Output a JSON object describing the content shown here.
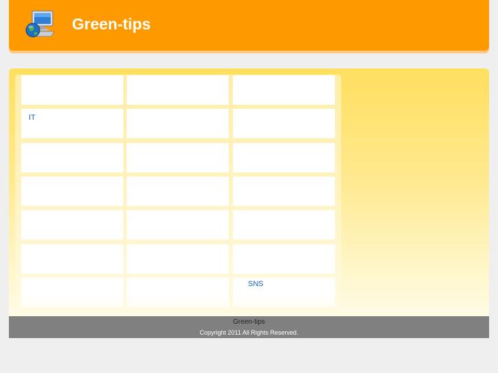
{
  "header": {
    "title": "Green-tips",
    "logo_icon": "computer-globe-icon",
    "background": "#ff9900"
  },
  "grid": {
    "rows": [
      [
        "",
        "",
        ""
      ],
      [
        "IT",
        "",
        ""
      ],
      [
        "",
        "",
        ""
      ],
      [
        "",
        "",
        ""
      ],
      [
        "",
        "",
        ""
      ],
      [
        "",
        "",
        ""
      ],
      [
        "",
        "",
        "SNS"
      ]
    ],
    "link_color": "#1a5fb4"
  },
  "footer": {
    "title": "Green-tips",
    "copyright": "Copyright 2011  All Rights Reserved.",
    "background": "#808080"
  }
}
